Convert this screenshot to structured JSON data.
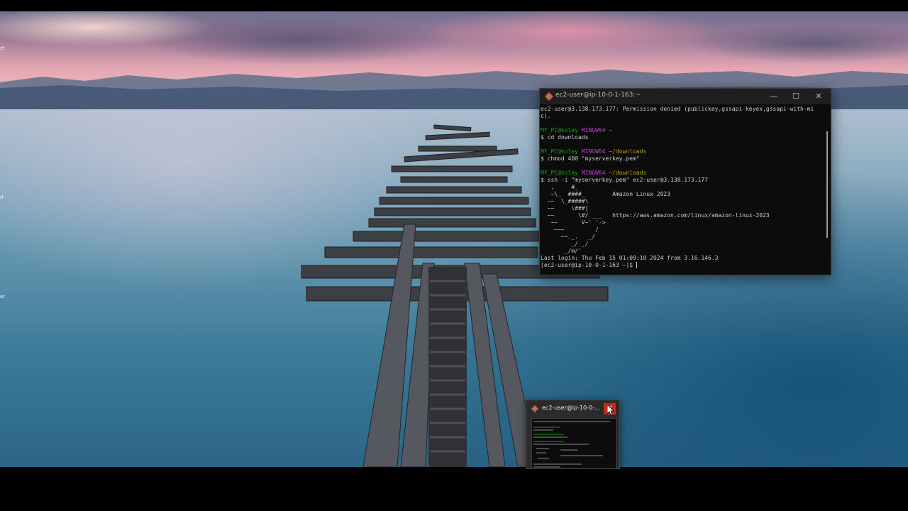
{
  "terminal": {
    "title": "ec2-user@ip-10-0-1-163:~",
    "controls": {
      "minimize": "—",
      "maximize": "☐",
      "close": "✕"
    },
    "lines": [
      [
        {
          "t": "ec2-user@3.138.173.177: Permission denied (publickey,gssapi-keyex,gssapi-with-mi",
          "c": ""
        }
      ],
      [
        {
          "t": "c).",
          "c": ""
        }
      ],
      [
        {
          "t": "",
          "c": ""
        }
      ],
      [
        {
          "t": "MY_PC@koley ",
          "c": "g"
        },
        {
          "t": "MINGW64 ",
          "c": "m"
        },
        {
          "t": "~",
          "c": "y"
        }
      ],
      [
        {
          "t": "$ cd downloads",
          "c": ""
        }
      ],
      [
        {
          "t": "",
          "c": ""
        }
      ],
      [
        {
          "t": "MY_PC@koley ",
          "c": "g"
        },
        {
          "t": "MINGW64 ",
          "c": "m"
        },
        {
          "t": "~/downloads",
          "c": "y"
        }
      ],
      [
        {
          "t": "$ chmod 400 \"myserverkey.pem\"",
          "c": ""
        }
      ],
      [
        {
          "t": "",
          "c": ""
        }
      ],
      [
        {
          "t": "MY_PC@koley ",
          "c": "g"
        },
        {
          "t": "MINGW64 ",
          "c": "m"
        },
        {
          "t": "~/downloads",
          "c": "y"
        }
      ],
      [
        {
          "t": "$ ssh -i \"myserverkey.pem\" ec2-user@3.138.173.177",
          "c": ""
        }
      ],
      [
        {
          "t": "   ,     #_",
          "c": ""
        }
      ],
      [
        {
          "t": "   ~\\_  ####_        Amazon Linux 2023",
          "c": ""
        }
      ],
      [
        {
          "t": "  ~~  \\_#####\\",
          "c": ""
        }
      ],
      [
        {
          "t": "  ~~     \\###|",
          "c": ""
        }
      ],
      [
        {
          "t": "  ~~       \\#/ ___   https://aws.amazon.com/linux/amazon-linux-2023",
          "c": ""
        }
      ],
      [
        {
          "t": "   ~~       V~' '->",
          "c": ""
        }
      ],
      [
        {
          "t": "    ~~~         /",
          "c": ""
        }
      ],
      [
        {
          "t": "      ~~._.   _/",
          "c": ""
        }
      ],
      [
        {
          "t": "         _/ _/",
          "c": ""
        }
      ],
      [
        {
          "t": "       _/m/'",
          "c": ""
        }
      ],
      [
        {
          "t": "Last login: Thu Feb 15 01:09:10 2024 from 3.16.146.3",
          "c": ""
        }
      ],
      [
        {
          "t": "[ec2-user@ip-10-0-1-163 ~]$ ",
          "c": ""
        }
      ]
    ]
  },
  "thumbnail": {
    "title": "ec2-user@ip-10-0-...",
    "close": "✕"
  },
  "desktop_edge_labels": [
    "et",
    "d",
    "et"
  ],
  "colors": {
    "prompt_user": "#13a10e",
    "prompt_shell": "#b148c6",
    "prompt_path": "#c19c00",
    "close_red": "#c42b1c"
  }
}
